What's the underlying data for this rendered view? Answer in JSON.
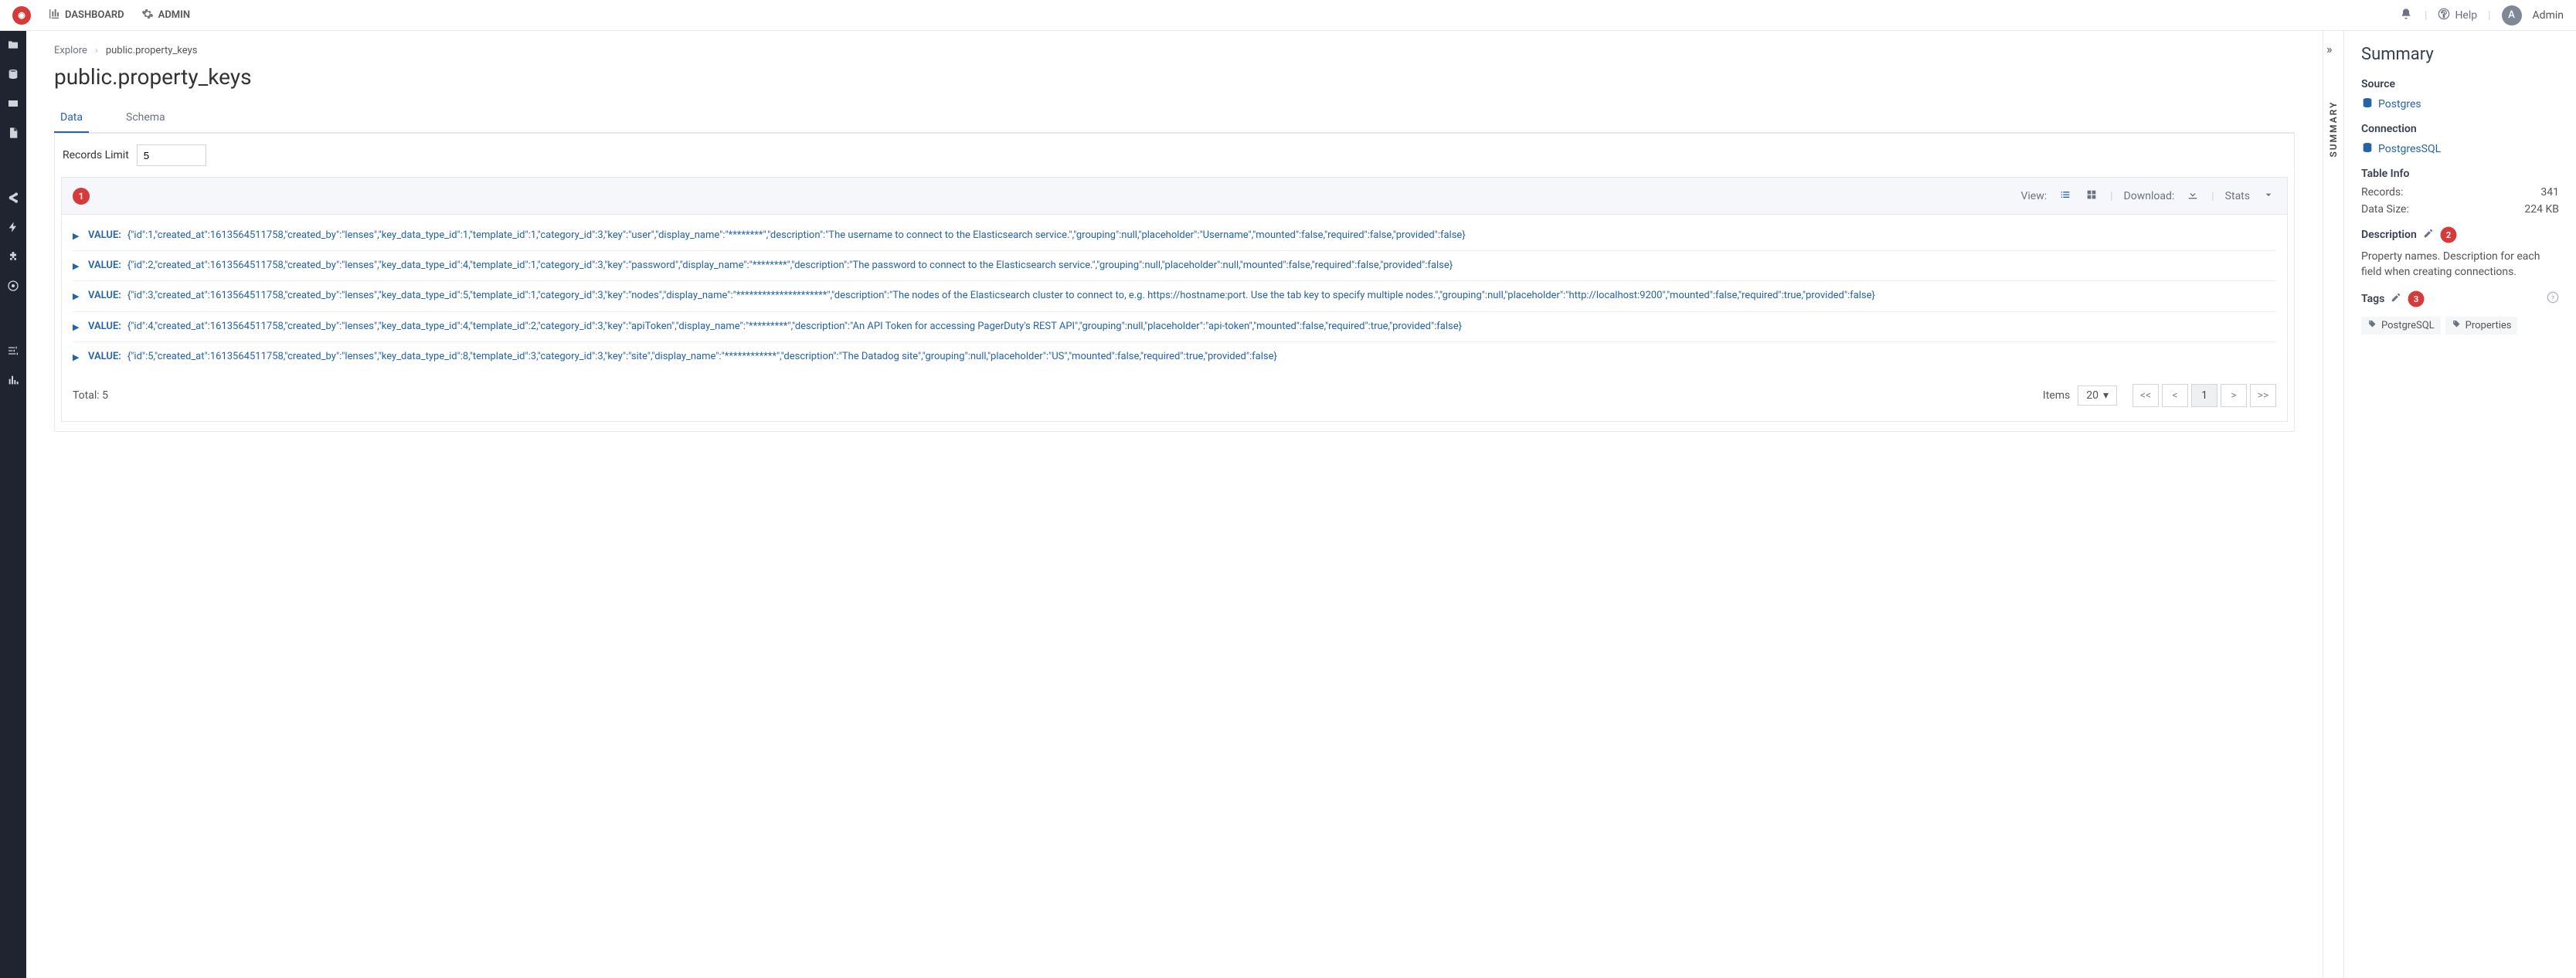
{
  "topnav": {
    "dashboard": "DASHBOARD",
    "admin": "ADMIN",
    "help": "Help",
    "user_initial": "A",
    "user_name": "Admin"
  },
  "breadcrumb": {
    "root": "Explore",
    "current": "public.property_keys"
  },
  "page_title": "public.property_keys",
  "tabs": {
    "data": "Data",
    "schema": "Schema"
  },
  "limit": {
    "label": "Records Limit",
    "value": "5"
  },
  "annotations": {
    "head": "1",
    "desc": "2",
    "tags": "3"
  },
  "panelhead": {
    "view": "View:",
    "download": "Download:",
    "stats": "Stats"
  },
  "rows": [
    {
      "label": "VALUE:",
      "json": "{\"id\":1,\"created_at\":1613564511758,\"created_by\":\"lenses\",\"key_data_type_id\":1,\"template_id\":1,\"category_id\":3,\"key\":\"user\",\"display_name\":\"********\",\"description\":\"The username to connect to the Elasticsearch service.\",\"grouping\":null,\"placeholder\":\"Username\",\"mounted\":false,\"required\":false,\"provided\":false}"
    },
    {
      "label": "VALUE:",
      "json": "{\"id\":2,\"created_at\":1613564511758,\"created_by\":\"lenses\",\"key_data_type_id\":4,\"template_id\":1,\"category_id\":3,\"key\":\"password\",\"display_name\":\"********\",\"description\":\"The password to connect to the Elasticsearch service.\",\"grouping\":null,\"placeholder\":null,\"mounted\":false,\"required\":false,\"provided\":false}"
    },
    {
      "label": "VALUE:",
      "json": "{\"id\":3,\"created_at\":1613564511758,\"created_by\":\"lenses\",\"key_data_type_id\":5,\"template_id\":1,\"category_id\":3,\"key\":\"nodes\",\"display_name\":\"*********************\",\"description\":\"The nodes of the Elasticsearch cluster to connect to, e.g. https://hostname:port. Use the tab key to specify multiple nodes.\",\"grouping\":null,\"placeholder\":\"http://localhost:9200\",\"mounted\":false,\"required\":true,\"provided\":false}"
    },
    {
      "label": "VALUE:",
      "json": "{\"id\":4,\"created_at\":1613564511758,\"created_by\":\"lenses\",\"key_data_type_id\":4,\"template_id\":2,\"category_id\":3,\"key\":\"apiToken\",\"display_name\":\"*********\",\"description\":\"An API Token for accessing PagerDuty's REST API\",\"grouping\":null,\"placeholder\":\"api-token\",\"mounted\":false,\"required\":true,\"provided\":false}"
    },
    {
      "label": "VALUE:",
      "json": "{\"id\":5,\"created_at\":1613564511758,\"created_by\":\"lenses\",\"key_data_type_id\":8,\"template_id\":3,\"category_id\":3,\"key\":\"site\",\"display_name\":\"************\",\"description\":\"The Datadog site\",\"grouping\":null,\"placeholder\":\"US\",\"mounted\":false,\"required\":true,\"provided\":false}"
    }
  ],
  "footer": {
    "total": "Total: 5",
    "items_label": "Items",
    "items_value": "20",
    "pager": {
      "first": "<<",
      "prev": "<",
      "page": "1",
      "next": ">",
      "last": ">>"
    }
  },
  "rail": {
    "label": "SUMMARY"
  },
  "summary": {
    "title": "Summary",
    "source_h": "Source",
    "source_link": "Postgres",
    "conn_h": "Connection",
    "conn_link": "PostgresSQL",
    "table_h": "Table Info",
    "records_k": "Records:",
    "records_v": "341",
    "size_k": "Data Size:",
    "size_v": "224 KB",
    "desc_h": "Description",
    "desc_text": "Property names. Description for each field when creating connections.",
    "tags_h": "Tags",
    "tags": [
      "PostgreSQL",
      "Properties"
    ]
  }
}
